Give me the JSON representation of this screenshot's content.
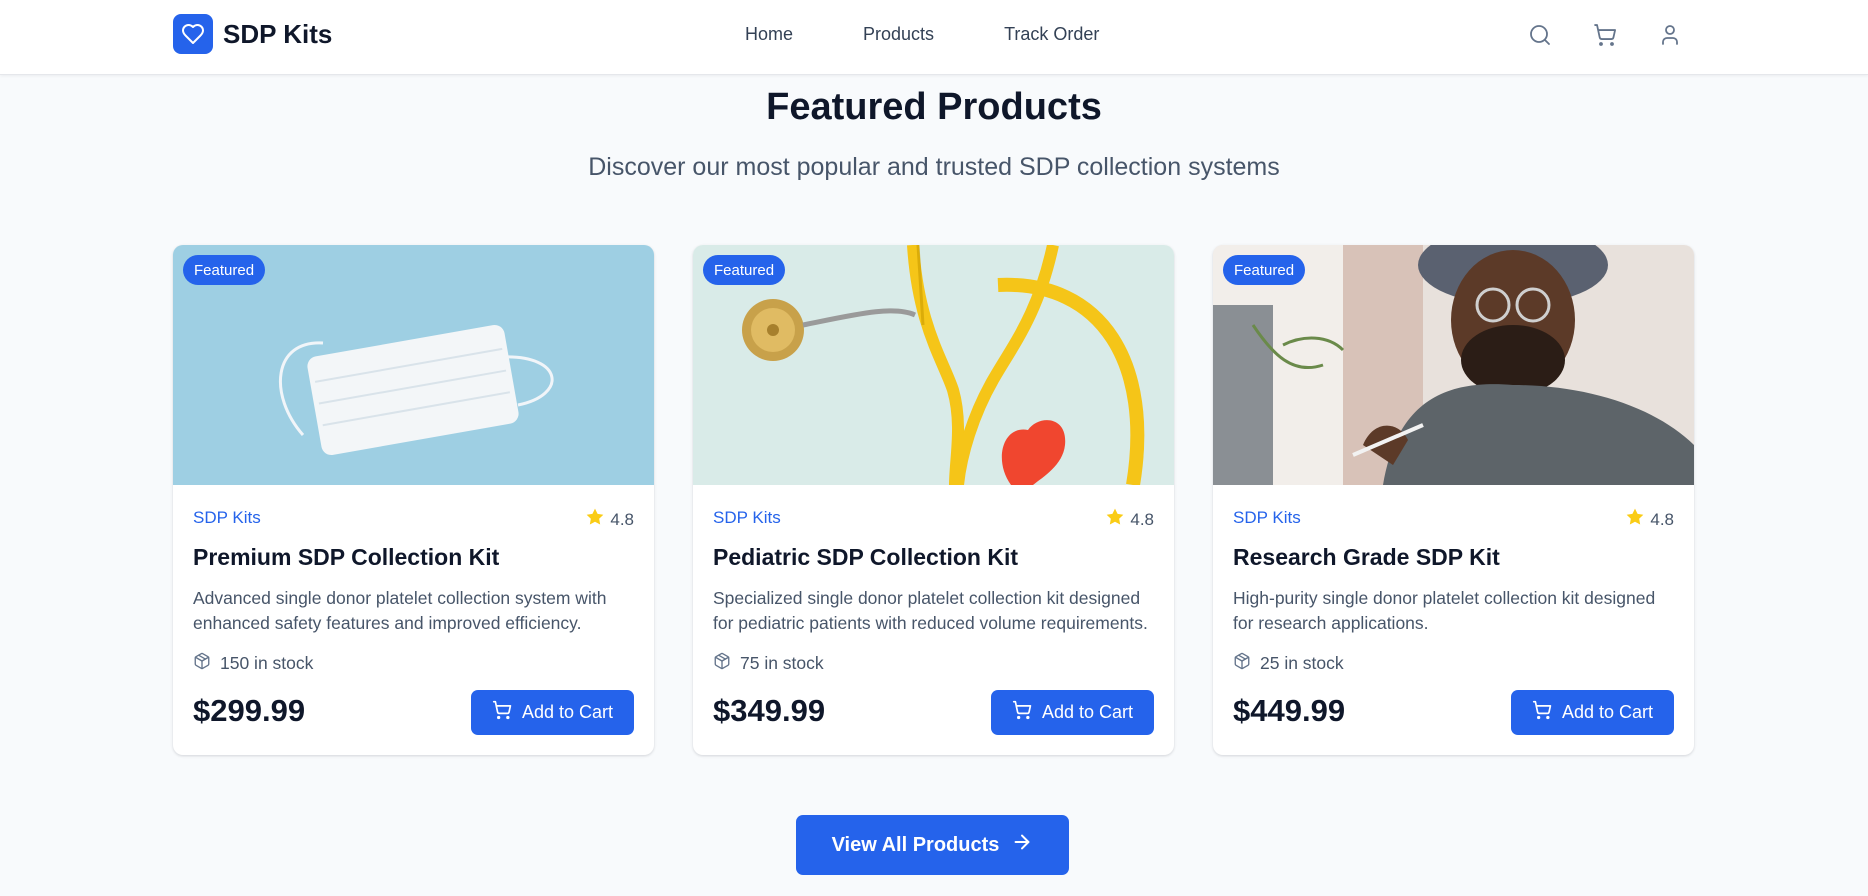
{
  "header": {
    "brand_name": "SDP Kits",
    "nav": [
      "Home",
      "Products",
      "Track Order"
    ],
    "icons": [
      "search-icon",
      "cart-icon",
      "user-icon"
    ]
  },
  "hero": {
    "title": "Featured Products",
    "subtitle": "Discover our most popular and trusted SDP collection systems"
  },
  "products": [
    {
      "badge": "Featured",
      "image": "surgical-mask-on-blue-background",
      "brand": "SDP Kits",
      "rating": "4.8",
      "title": "Premium SDP Collection Kit",
      "description": "Advanced single donor platelet collection system with enhanced safety features and improved efficiency.",
      "stock": "150 in stock",
      "price": "$299.99",
      "button": "Add to Cart"
    },
    {
      "badge": "Featured",
      "image": "yellow-stethoscope-with-red-heart",
      "brand": "SDP Kits",
      "rating": "4.8",
      "title": "Pediatric SDP Collection Kit",
      "description": "Specialized single donor platelet collection kit designed for pediatric patients with reduced volume requirements.",
      "stock": "75 in stock",
      "price": "$349.99",
      "button": "Add to Cart"
    },
    {
      "badge": "Featured",
      "image": "medical-professional-at-laptop",
      "brand": "SDP Kits",
      "rating": "4.8",
      "title": "Research Grade SDP Kit",
      "description": "High-purity single donor platelet collection kit designed for research applications.",
      "stock": "25 in stock",
      "price": "$449.99",
      "button": "Add to Cart"
    }
  ],
  "cta": {
    "label": "View All Products"
  },
  "colors": {
    "primary": "#2563eb",
    "star": "#facc15",
    "page_bg": "#f8fafc",
    "heading": "#0f172a",
    "muted": "#475569"
  }
}
